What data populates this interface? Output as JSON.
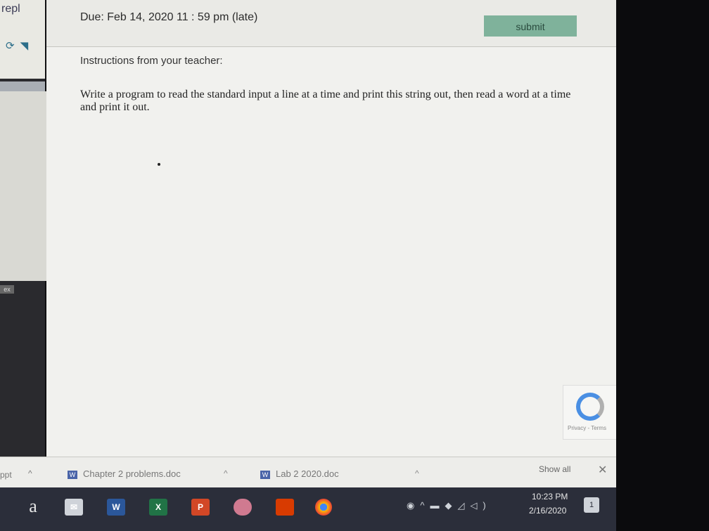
{
  "sidebar": {
    "title": "repl",
    "tag": "ex"
  },
  "assignment": {
    "due": "Due: Feb 14, 2020 11 : 59 pm (late)",
    "submit_label": "submit",
    "instructions_heading": "Instructions from your teacher:",
    "instructions_text": "Write a program to read the standard input a line at a time and print this string out, then read a word at a time and print it out."
  },
  "recaptcha": {
    "text": "Privacy - Terms"
  },
  "downloads": {
    "partial_item": "ppt",
    "items": [
      {
        "name": "Chapter 2 problems.doc"
      },
      {
        "name": "Lab 2 2020.doc"
      }
    ],
    "show_all": "Show all",
    "close": "✕"
  },
  "taskbar": {
    "time": "10:23 PM",
    "date": "2/16/2020",
    "icons": [
      "amazon-icon",
      "mail-icon",
      "word-icon",
      "excel-icon",
      "powerpoint-icon",
      "brain-icon",
      "office-icon",
      "chrome-icon"
    ],
    "notification_count": "1"
  }
}
